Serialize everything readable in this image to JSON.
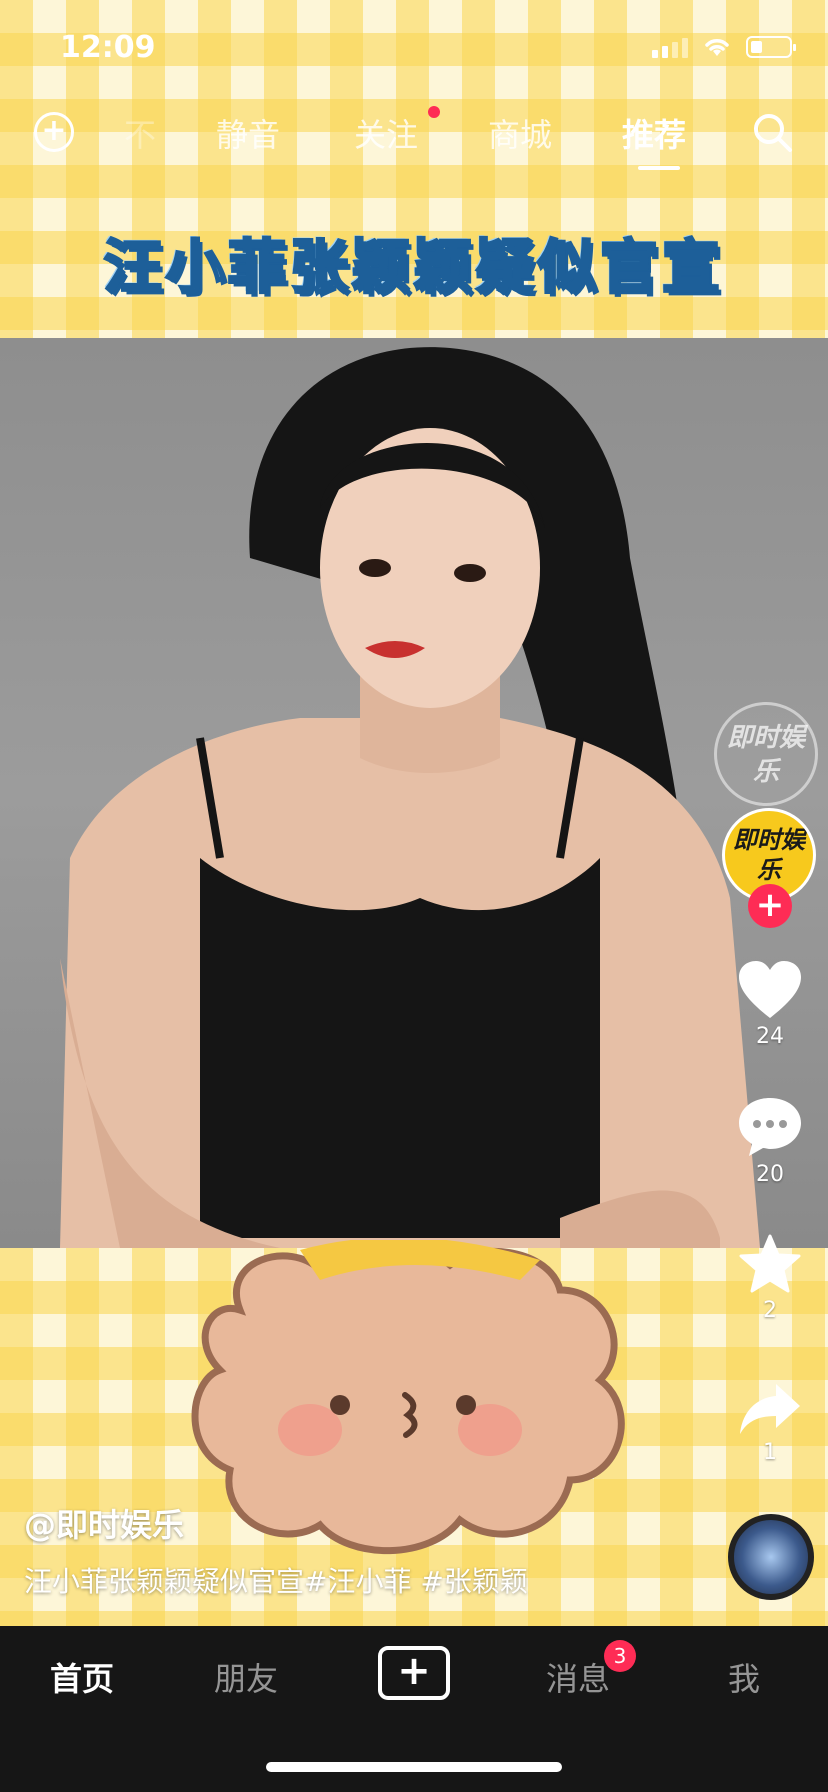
{
  "status_bar": {
    "time": "12:09",
    "battery_level_pct": 30
  },
  "top_nav": {
    "tabs": [
      {
        "label": "不",
        "state": "faded"
      },
      {
        "label": "静音",
        "state": "normal"
      },
      {
        "label": "关注",
        "state": "normal",
        "dot": true
      },
      {
        "label": "商城",
        "state": "normal"
      },
      {
        "label": "推荐",
        "state": "active"
      }
    ],
    "add_icon": "plus-circle-icon",
    "search_icon": "search-icon"
  },
  "video": {
    "title_banner": "汪小菲张颖颖疑似官宣",
    "watermark": "即时娱乐",
    "author_avatar_text": "即时娱乐",
    "username": "@即时娱乐",
    "caption": "汪小菲张颖颖疑似官宣#汪小菲 #张颖颖"
  },
  "actions": {
    "likes": "24",
    "comments": "20",
    "favorites": "2",
    "shares": "1"
  },
  "bottom_nav": {
    "items": [
      {
        "label": "首页",
        "active": true
      },
      {
        "label": "朋友"
      },
      {
        "label": "消息",
        "badge": "3"
      },
      {
        "label": "我"
      }
    ]
  },
  "colors": {
    "accent": "#fe2c55",
    "banner_stroke": "#1d5f99",
    "gingham": "#fad650"
  }
}
